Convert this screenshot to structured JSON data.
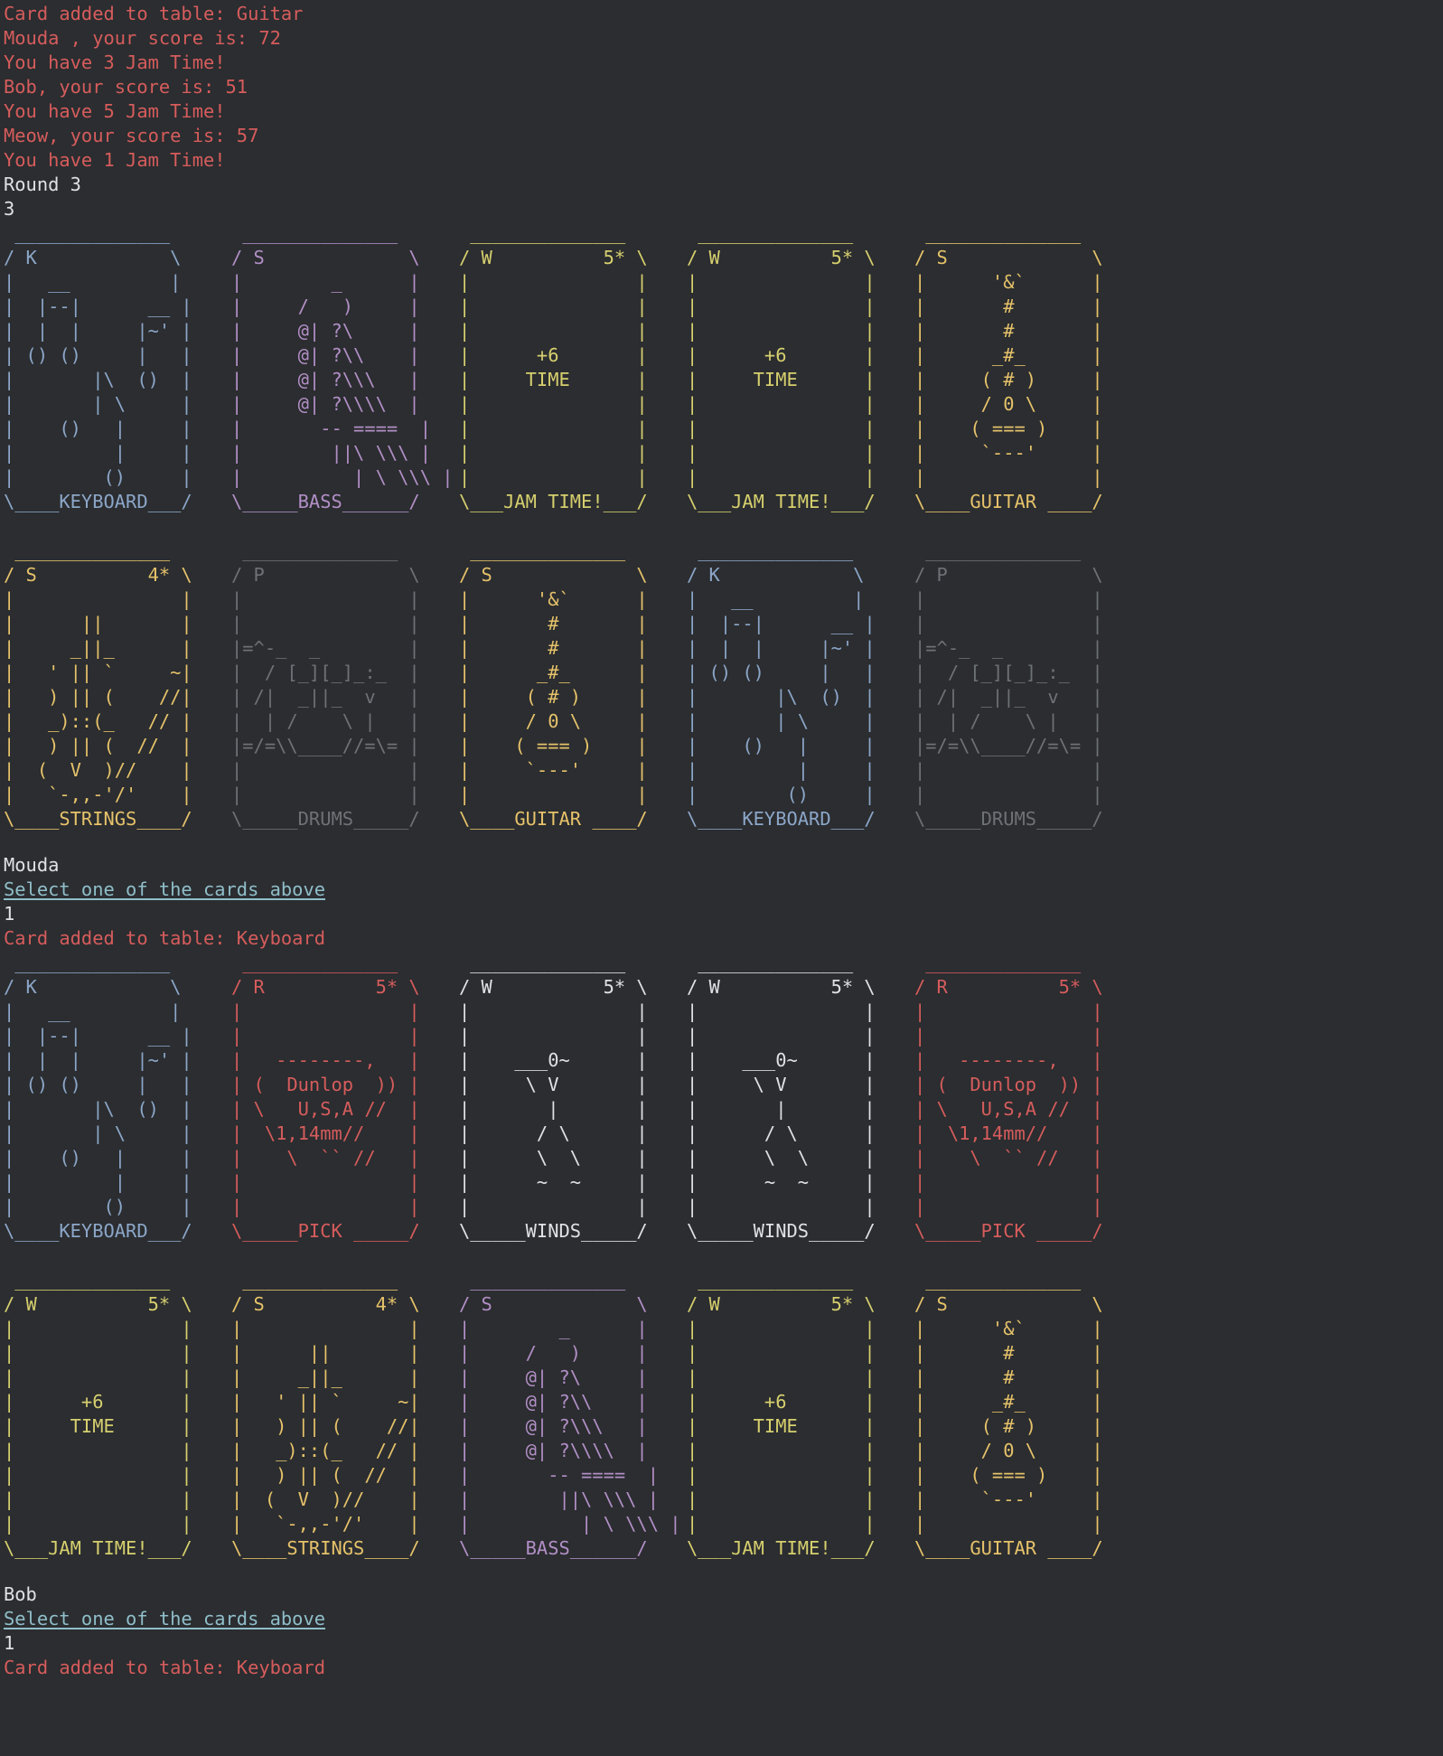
{
  "colors": {
    "background": "#2b2d30",
    "message_red": "#d65c5c",
    "text_white": "#dfe1e5",
    "prompt_link": "#8fbec9",
    "keyboard_blue": "#8ca6c8",
    "bass_purple": "#b28fc6",
    "jam_time_yellow": "#d6cf6e",
    "guitar_gold": "#e6c26a",
    "drums_gray": "#6e7175",
    "pick_red": "#d65c5c",
    "winds_white": "#dfe1e5"
  },
  "log_top": [
    "Card added to table: Guitar",
    "Mouda , your score is: 72",
    "You have 3 Jam Time!",
    "Bob, your score is: 51",
    "You have 5 Jam Time!",
    "Meow, your score is: 57",
    "You have 1 Jam Time!"
  ],
  "round_label": "Round 3",
  "round_number": "3",
  "card_art": {
    "keyboard": " ______________\n/ K            \\\n|   __         |\n|  |--|      __ |\n|  |  |     |~' |\n| () ()     |   |\n|       |\\  ()  |\n|       | \\     |\n|    ()   |     |\n|         |     |\n|        ()     |\n\\____KEYBOARD___/",
    "bass": " ______________\n/ S             \\\n|        _      |\n|     /   )     |\n|     @| ?\\     |\n|     @| ?\\\\    |\n|     @| ?\\\\\\   |\n|     @| ?\\\\\\\\  |\n|       -- ====  |\n|        ||\\ \\\\\\ |\n|          | \\ \\\\\\ |\n\\_____BASS______/",
    "jam_time_5": " ______________\n/ W          5* \\\n|               |\n|               |\n|               |\n|      +6       |\n|     TIME      |\n|               |\n|               |\n|               |\n|               |\n\\___JAM TIME!___/",
    "guitar": " ______________\n/ S             \\\n|      '&`      |\n|       #       |\n|       #       |\n|      _#_      |\n|     ( # )     |\n|     / 0 \\     |\n|    ( === )    |\n|     `---'     |\n|               |\n\\____GUITAR ____/",
    "strings_4": " ______________\n/ S          4* \\\n|               |\n|      ||       |\n|     _||_      |\n|   ' || `     ~|\n|   ) || (    //|\n|   _)::(_   // |\n|   ) || (  //  |\n|  (  V  )//    |\n|   `-,,-'/'    |\n\\____STRINGS____/",
    "drums": " ______________\n/ P             \\\n|               |\n|               |\n|=^-_  _        |\n|  / [_][_]_:_  |\n| /|  _||_  v   |\n|  | /    \\ |   |\n|=/=\\\\____//=\\= |\n|               |\n|               |\n\\_____DRUMS_____/",
    "pick_5": " ______________\n/ R          5* \\\n|               |\n|               |\n|   --------,   |\n| (  Dunlop  )) |\n| \\   U,S,A //  |\n|  \\1,14mm//    |\n|    \\  `` //   |\n|               |\n|               |\n\\_____PICK _____/",
    "winds_5": " ______________\n/ W          5* \\\n|               |\n|               |\n|    ___0~      |\n|     \\ V       |\n|       |       |\n|      / \\      |\n|      \\  \\     |\n|      ~  ~     |\n|               |\n\\_____WINDS_____/"
  },
  "sections": [
    {
      "rows": [
        [
          {
            "art": "keyboard",
            "color": "#8ca6c8",
            "name": "card-keyboard"
          },
          {
            "art": "bass",
            "color": "#b28fc6",
            "name": "card-bass"
          },
          {
            "art": "jam_time_5",
            "color": "#d6cf6e",
            "name": "card-jam-time"
          },
          {
            "art": "jam_time_5",
            "color": "#d6cf6e",
            "name": "card-jam-time"
          },
          {
            "art": "guitar",
            "color": "#e6c26a",
            "name": "card-guitar"
          }
        ],
        [
          {
            "art": "strings_4",
            "color": "#e6c26a",
            "name": "card-strings"
          },
          {
            "art": "drums",
            "color": "#6e7175",
            "name": "card-drums"
          },
          {
            "art": "guitar",
            "color": "#e6c26a",
            "name": "card-guitar"
          },
          {
            "art": "keyboard",
            "color": "#8ca6c8",
            "name": "card-keyboard"
          },
          {
            "art": "drums",
            "color": "#6e7175",
            "name": "card-drums"
          }
        ]
      ],
      "player": "Mouda",
      "prompt": "Select one of the cards above",
      "input": "1",
      "result": "Card added to table: Keyboard"
    },
    {
      "rows": [
        [
          {
            "art": "keyboard",
            "color": "#8ca6c8",
            "name": "card-keyboard"
          },
          {
            "art": "pick_5",
            "color": "#d65c5c",
            "name": "card-pick"
          },
          {
            "art": "winds_5",
            "color": "#dfe1e5",
            "name": "card-winds"
          },
          {
            "art": "winds_5",
            "color": "#dfe1e5",
            "name": "card-winds"
          },
          {
            "art": "pick_5",
            "color": "#d65c5c",
            "name": "card-pick"
          }
        ],
        [
          {
            "art": "jam_time_5",
            "color": "#d6cf6e",
            "name": "card-jam-time"
          },
          {
            "art": "strings_4",
            "color": "#e6c26a",
            "name": "card-strings"
          },
          {
            "art": "bass",
            "color": "#b28fc6",
            "name": "card-bass"
          },
          {
            "art": "jam_time_5",
            "color": "#d6cf6e",
            "name": "card-jam-time"
          },
          {
            "art": "guitar",
            "color": "#e6c26a",
            "name": "card-guitar"
          }
        ]
      ],
      "player": "Bob",
      "prompt": "Select one of the cards above",
      "input": "1",
      "result": "Card added to table: Keyboard"
    }
  ]
}
